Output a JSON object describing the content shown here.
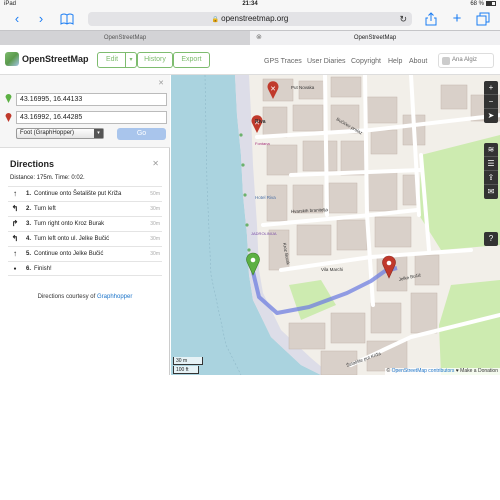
{
  "statusbar": {
    "device": "iPad",
    "time": "21:34",
    "battery": "68 %"
  },
  "safari": {
    "url": "openstreetmap.org",
    "back_icon": "chevron-left-icon",
    "forward_icon": "chevron-right-icon"
  },
  "tabs": [
    {
      "label": "OpenStreetMap"
    },
    {
      "label": "OpenStreetMap"
    }
  ],
  "header": {
    "brand": "OpenStreetMap",
    "edit": "Edit",
    "history": "History",
    "export": "Export",
    "links": [
      "GPS Traces",
      "User Diaries",
      "Copyright",
      "Help",
      "About"
    ],
    "user": "Ana Algiz"
  },
  "route": {
    "from": "43.16995, 16.44133",
    "to": "43.16992, 16.44285",
    "engine": "Foot (GraphHopper)",
    "go": "Go"
  },
  "directions": {
    "title": "Directions",
    "summary": "Distance: 175m. Time: 0:02.",
    "steps": [
      {
        "icon": "straight-arrow-icon",
        "glyph": "↑",
        "num": "1.",
        "text": "Continue onto Šetalište put Križa",
        "dist": "50m"
      },
      {
        "icon": "turn-left-icon",
        "glyph": "↰",
        "num": "2.",
        "text": "Turn left",
        "dist": "30m"
      },
      {
        "icon": "turn-right-icon",
        "glyph": "↱",
        "num": "3.",
        "text": "Turn right onto Kroz Burak",
        "dist": "30m"
      },
      {
        "icon": "turn-left-icon",
        "glyph": "↰",
        "num": "4.",
        "text": "Turn left onto ul. Jelke Bučić",
        "dist": "30m"
      },
      {
        "icon": "straight-arrow-icon",
        "glyph": "↑",
        "num": "5.",
        "text": "Continue onto Jelke Bučić",
        "dist": "30m"
      },
      {
        "icon": "finish-dot-icon",
        "glyph": "●",
        "num": "6.",
        "text": "Finish!",
        "dist": ""
      }
    ],
    "courtesy_prefix": "Directions courtesy of",
    "courtesy_link": "Graphhopper"
  },
  "map": {
    "scale_m": "30 m",
    "scale_ft": "100 ft",
    "attribution_prefix": "© ",
    "attribution_link": "OpenStreetMap contributors",
    "attribution_suffix": " ♥ Make a Donation",
    "controls": [
      "+",
      "−",
      "➤",
      "≋",
      "☰",
      "⇪",
      "✉",
      "?"
    ],
    "labels": {
      "riva": "Riva",
      "hotel": "Hotel Riva",
      "jadrolinija": "JADROLINIJA",
      "fontana": "Fontana",
      "hvarskih": "Hvarskih branitelja",
      "kroz_burak": "Kroz Burak",
      "jelke": "Jelke Bučić",
      "vila_marchi": "Vila Marchi",
      "setaliste": "Šetalište put Križa",
      "novaka": "Put Novaka",
      "bucicev": "Bučićev prolaz"
    },
    "colors": {
      "route": "#6f7fe0",
      "water": "#aad3df",
      "green_pin": "#5cb043",
      "red_pin": "#c0392b"
    }
  }
}
